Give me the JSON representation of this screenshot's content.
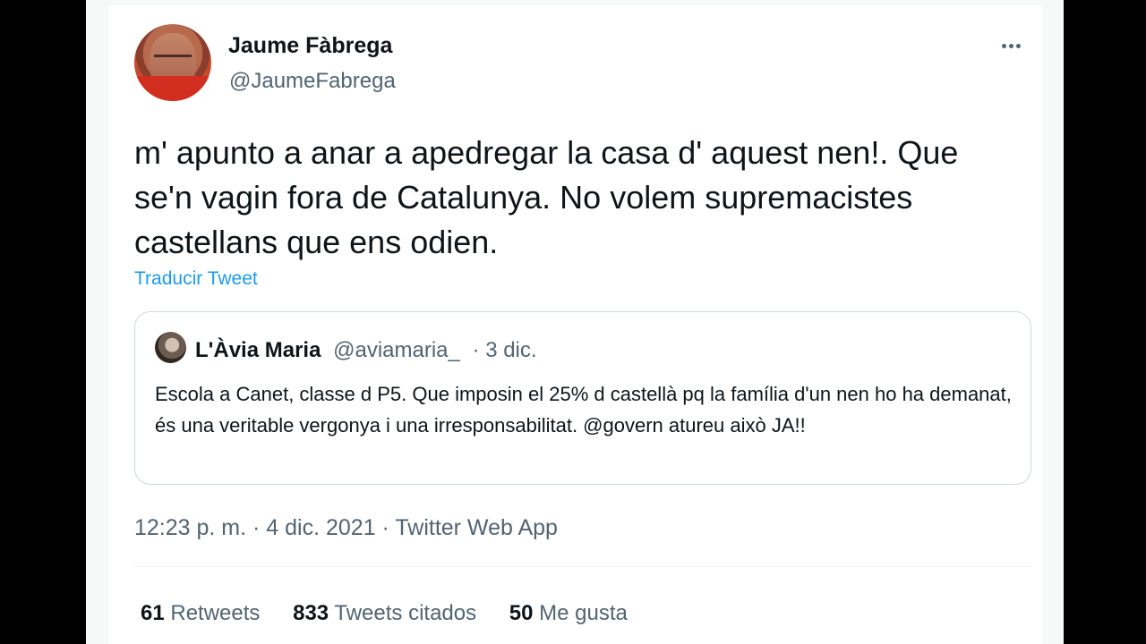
{
  "tweet": {
    "author": {
      "name": "Jaume Fàbrega",
      "handle": "@JaumeFabrega"
    },
    "text": "m' apunto a anar a apedregar la casa d' aquest nen!. Que se'n vagin fora de Catalunya. No volem supremacistes castellans que ens odien.",
    "translate_label": "Traducir Tweet",
    "quote": {
      "name": "L'Àvia Maria",
      "handle": "@aviamaria_",
      "date": "· 3 dic.",
      "text": "Escola a Canet, classe d P5. Que imposin el 25% d castellà pq la família d'un nen ho ha demanat, és una veritable vergonya i una irresponsabilitat. @govern atureu això JA!!"
    },
    "timestamp": "12:23 p. m. · 4 dic. 2021 · Twitter Web App",
    "stats": {
      "retweets_count": "61",
      "retweets_label": "Retweets",
      "quotes_count": "833",
      "quotes_label": "Tweets citados",
      "likes_count": "50",
      "likes_label": "Me gusta"
    }
  },
  "icons": {
    "more": "more-options-icon",
    "avatar": "avatar-image",
    "quote_avatar": "avatar-image"
  },
  "colors": {
    "text_primary": "#0f1419",
    "text_secondary": "#536471",
    "link": "#1d9bf0",
    "border": "#cfd9de",
    "divider": "#eff3f4"
  }
}
